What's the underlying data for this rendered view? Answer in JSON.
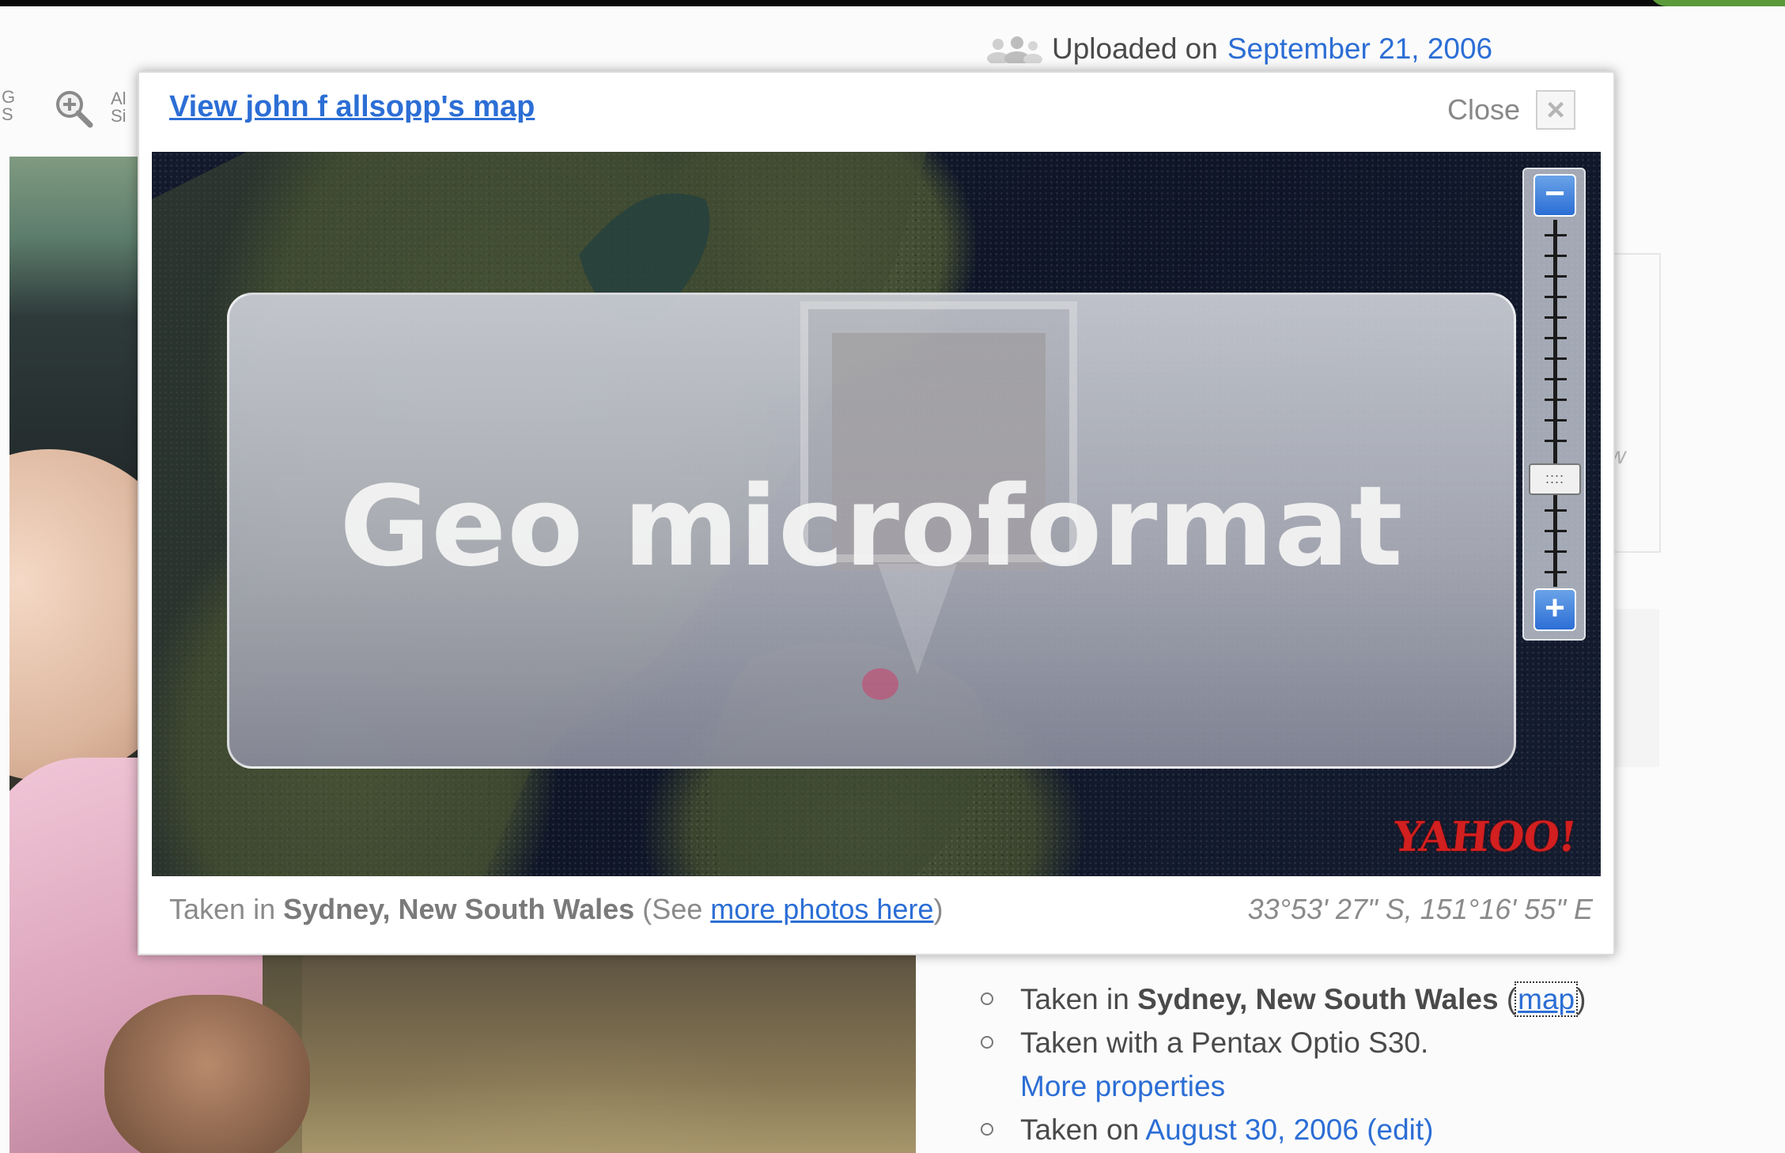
{
  "toolbar": {
    "left_text": "G\nS",
    "right_text": "Al\nSi",
    "zoom_icon": "magnifier-plus-icon"
  },
  "upload": {
    "label": "Uploaded on",
    "date": "September 21, 2006",
    "icon": "people-icon"
  },
  "side": {
    "partial_text": "w"
  },
  "popup": {
    "view_map_link": "View john f allsopp's map",
    "close_label": "Close",
    "close_icon": "close-icon",
    "map_provider": "YAHOO!",
    "zoom_out_label": "−",
    "zoom_in_label": "+",
    "zoom_handle_label": "::::",
    "footer": {
      "taken_in": "Taken in",
      "place": "Sydney, New South Wales",
      "see_open": "(See",
      "more_photos_link": "more photos here",
      "see_close": ")"
    },
    "coordinates": "33°53' 27\" S, 151°16' 55\" E"
  },
  "overlay": {
    "title": "Geo microformat"
  },
  "properties": [
    {
      "prefix": "Taken in",
      "place": "Sydney, New South Wales",
      "open": "(",
      "map_link": "map",
      "close": ")"
    },
    {
      "text": "Taken with a Pentax Optio S30."
    },
    {
      "more_link": "More properties"
    },
    {
      "prefix": "Taken on",
      "date_link": "August 30, 2006",
      "edit_link": "(edit)"
    }
  ],
  "colors": {
    "link_blue": "#2c6ed5",
    "yahoo_red": "#d21f1f",
    "zoom_blue": "#2c6ed5"
  }
}
